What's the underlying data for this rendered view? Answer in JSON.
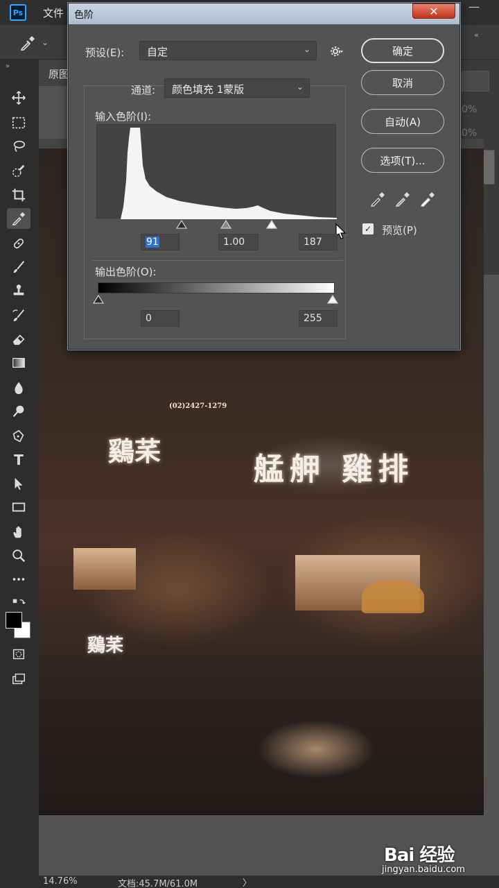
{
  "app": {
    "logo": "Ps",
    "menu_file": "文件",
    "window_min": "—",
    "doc_tab": "原图"
  },
  "statusbar": {
    "zoom": "14.76%",
    "doc_size": "文档:45.7M/61.0M",
    "arrow": "〉"
  },
  "right_panel": {
    "pct1": "0%",
    "pct2": "0%"
  },
  "canvas": {
    "sign_main": "艋舺 雞排",
    "sign_left": "鷄䒩",
    "sign_small": "鷄䒩",
    "sign_phone": "(02)2427-1279"
  },
  "dialog": {
    "title": "色阶",
    "close_label": "✕",
    "preset_label": "预设(E):",
    "preset_value": "自定",
    "channel_label": "通道:",
    "channel_value": "颜色填充 1蒙版",
    "input_levels_label": "输入色阶(I):",
    "input_black": "91",
    "input_gamma": "1.00",
    "input_white": "187",
    "output_levels_label": "输出色阶(O):",
    "output_black": "0",
    "output_white": "255",
    "ok_label": "确定",
    "cancel_label": "取消",
    "auto_label": "自动(A)",
    "options_label": "选项(T)...",
    "preview_label": "预览(P)",
    "preview_checked": true
  },
  "watermark": {
    "logo": "Bai 经验",
    "url": "jingyan.baidu.com"
  },
  "colors": {
    "accent_ps": "#31a8ff",
    "selection": "#2f6fd6",
    "close_button": "#c2321a"
  }
}
